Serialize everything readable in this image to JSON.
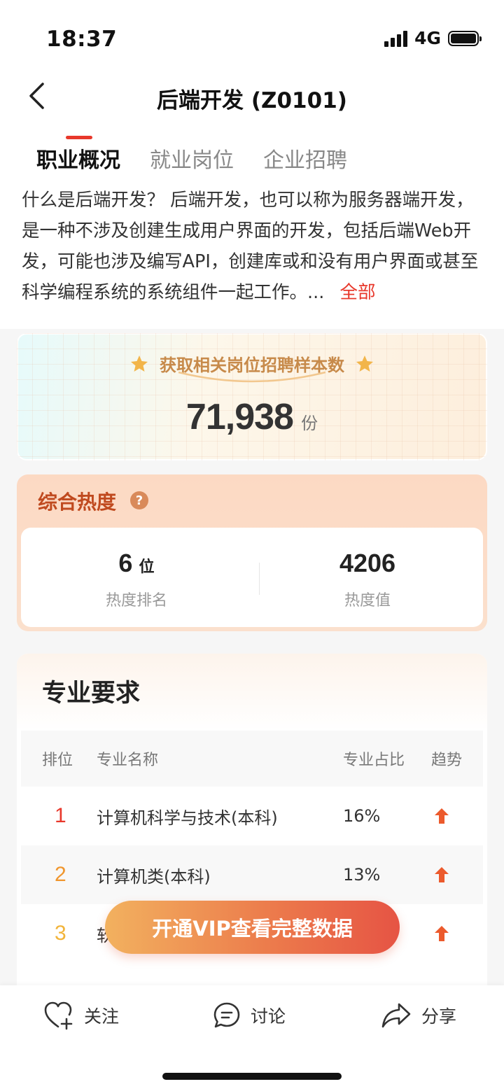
{
  "status_bar": {
    "time": "18:37",
    "network": "4G"
  },
  "nav": {
    "title": "后端开发 (Z0101)"
  },
  "tabs": [
    {
      "label": "职业概况"
    },
    {
      "label": "就业岗位"
    },
    {
      "label": "企业招聘"
    }
  ],
  "description": {
    "text": "什么是后端开发？ 后端开发，也可以称为服务器端开发，是一种不涉及创建生成用户界面的开发，包括后端Web开发，可能也涉及编写API，创建库或和没有用户界面或甚至科学编程系统的系统组件一起工作。...",
    "more_label": "全部"
  },
  "sample": {
    "title": "获取相关岗位招聘样本数",
    "value": "71,938",
    "unit": "份"
  },
  "heat": {
    "title": "综合热度",
    "help_symbol": "?",
    "rank": {
      "value": "6",
      "unit": "位",
      "label": "热度排名"
    },
    "score": {
      "value": "4206",
      "label": "热度值"
    }
  },
  "major": {
    "title": "专业要求",
    "headers": {
      "rank": "排位",
      "name": "专业名称",
      "ratio": "专业占比",
      "trend": "趋势"
    },
    "rows": [
      {
        "rank": "1",
        "name": "计算机科学与技术(本科)",
        "ratio": "16%",
        "trend": "up"
      },
      {
        "rank": "2",
        "name": "计算机类(本科)",
        "ratio": "13%",
        "trend": "up"
      },
      {
        "rank": "3",
        "name": "软",
        "ratio": "",
        "trend": "up"
      }
    ],
    "rank_colors": [
      "#e8382b",
      "#f0962e",
      "#f2b43a"
    ]
  },
  "vip": {
    "label": "开通VIP查看完整数据"
  },
  "bottom_bar": {
    "follow": "关注",
    "discuss": "讨论",
    "share": "分享"
  },
  "colors": {
    "accent": "#e8382b",
    "trend_up": "#ec5a2c"
  }
}
